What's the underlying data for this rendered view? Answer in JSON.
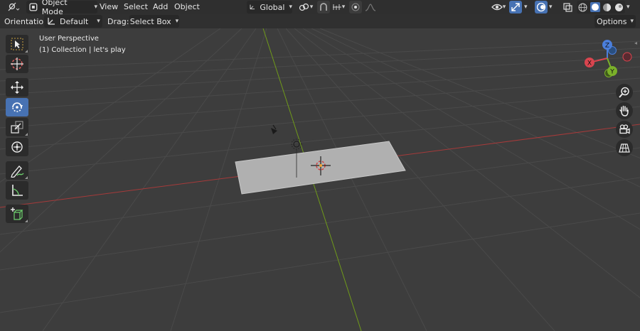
{
  "header": {
    "mode_label": "Object Mode",
    "menus": [
      "View",
      "Select",
      "Add",
      "Object"
    ],
    "transform_orientation": "Global"
  },
  "tool_settings": {
    "orientation_label": "Orientation:",
    "orientation_value": "Default",
    "drag_label": "Drag:",
    "drag_value": "Select Box",
    "options_label": "Options"
  },
  "overlay": {
    "view_name": "User Perspective",
    "collection_info": "(1) Collection | let's play"
  },
  "gizmo": {
    "z": "Z",
    "y": "Y",
    "x": "X"
  },
  "colors": {
    "x_axis": "#a63a3a",
    "y_axis": "#6f9a1a",
    "active_tool": "#4772b3",
    "plane": "#b0b0b0"
  },
  "icons": [
    "editor-type-icon",
    "object-mode-icon",
    "orientation-icon",
    "link-icon",
    "snap-icon",
    "proportional-edit-icon",
    "visibility-icon",
    "gizmo-icon",
    "overlay-icon",
    "xray-icon",
    "wireframe-shading-icon",
    "solid-shading-icon",
    "material-shading-icon",
    "rendered-shading-icon",
    "select-box-icon",
    "cursor-icon",
    "move-icon",
    "rotate-icon",
    "scale-icon",
    "transform-icon",
    "annotate-icon",
    "measure-icon",
    "add-cube-icon",
    "zoom-icon",
    "hand-pan-icon",
    "camera-icon",
    "grid-icon"
  ]
}
